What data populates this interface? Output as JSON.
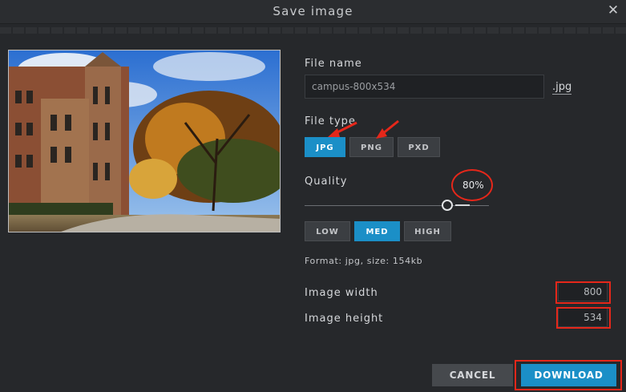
{
  "dialog": {
    "title": "Save image",
    "close_glyph": "✕"
  },
  "file": {
    "name_label": "File name",
    "name_value": "campus-800x534",
    "extension": ".jpg",
    "type_label": "File type",
    "types": [
      "JPG",
      "PNG",
      "PXD"
    ],
    "selected_type": "JPG"
  },
  "quality": {
    "label": "Quality",
    "value_text": "80%",
    "value": 80,
    "presets": [
      "LOW",
      "MED",
      "HIGH"
    ],
    "selected_preset": "MED"
  },
  "format_info": "Format: jpg, size: 154kb",
  "dimensions": {
    "width_label": "Image width",
    "width_value": "800",
    "height_label": "Image height",
    "height_value": "534"
  },
  "actions": {
    "cancel": "CANCEL",
    "download": "DOWNLOAD"
  },
  "colors": {
    "accent": "#1b8fc7",
    "annotation": "#e5271a",
    "background": "#26282b"
  },
  "icons": {
    "close": "close-icon",
    "annotation_arrows": "arrow-icon"
  }
}
